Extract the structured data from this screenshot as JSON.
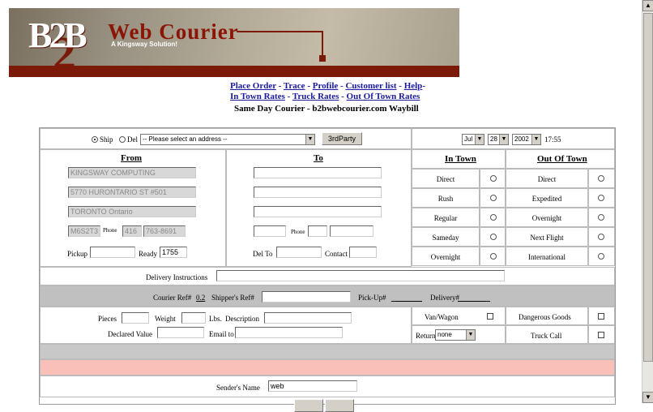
{
  "banner": {
    "logo": "B2B",
    "title": "Web Courier",
    "subtitle": "A Kingsway Solution!"
  },
  "nav": {
    "row1": [
      "Place Order",
      "Trace",
      "Profile",
      "Customer list",
      "Help"
    ],
    "row2": [
      "In Town Rates",
      "Truck Rates",
      "Out Of Town Rates"
    ],
    "separator": " - ",
    "heading": "Same Day Courier - b2bwebcourier.com Waybill"
  },
  "top": {
    "ship_label": "Ship",
    "del_label": "Del",
    "address_select": "-- Please select an address --",
    "third_party_button": "3rdParty",
    "month": "Jul",
    "day": "28",
    "year": "2002",
    "time": "17:55"
  },
  "from": {
    "header": "From",
    "company": "KINGSWAY COMPUTING",
    "street": "5770 HURONTARIO ST #501",
    "city": "TORONTO Ontario",
    "postal": "M6S2T3",
    "phone_label": "Phone",
    "area_code": "416",
    "phone": "763-8691",
    "pickup_label": "Pickup",
    "ready_label": "Ready",
    "ready_value": "1755"
  },
  "to": {
    "header": "To",
    "phone_label": "Phone",
    "del_to_label": "Del To",
    "contact_label": "Contact"
  },
  "in_town": {
    "header": "In Town",
    "options": [
      "Direct",
      "Rush",
      "Regular",
      "Sameday",
      "Overnight"
    ]
  },
  "out_of_town": {
    "header": "Out Of Town",
    "options": [
      "Direct",
      "Expedited",
      "Overnight",
      "Next Flight",
      "International"
    ]
  },
  "delivery_instructions_label": "Delivery Instructions",
  "refs": {
    "courier_ref_label": "Courier Ref#",
    "courier_ref_value": "0.2",
    "shipper_ref_label": "Shipper's Ref#",
    "pickup_num_label": "Pick-Up#",
    "delivery_num_label": "Delivery#"
  },
  "details": {
    "pieces_label": "Pieces",
    "weight_label": "Weight",
    "lbs_label": "Lbs.",
    "description_label": "Description",
    "declared_value_label": "Declared Value",
    "email_to_label": "Email to"
  },
  "options": {
    "van_wagon_label": "Van/Wagon",
    "dangerous_goods_label": "Dangerous Goods",
    "return_label": "Return",
    "return_value": "none",
    "truck_call_label": "Truck Call"
  },
  "sender": {
    "label": "Sender's Name",
    "value": "web"
  }
}
